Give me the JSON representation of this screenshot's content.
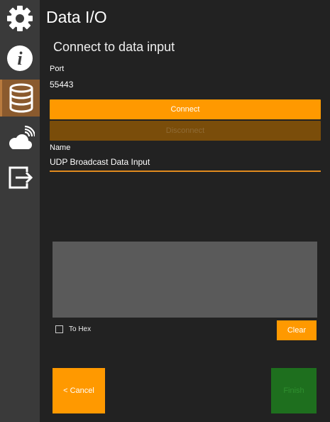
{
  "app": {
    "title": "Data I/O"
  },
  "section": {
    "title": "Connect to data input"
  },
  "sidebar": {
    "items": [
      {
        "icon": "gear-icon"
      },
      {
        "icon": "info-icon"
      },
      {
        "icon": "database-icon",
        "active": true
      },
      {
        "icon": "cloud-wifi-icon"
      },
      {
        "icon": "export-icon"
      }
    ]
  },
  "port": {
    "label": "Port",
    "value": "55443"
  },
  "connect": {
    "label": "Connect"
  },
  "disconnect": {
    "label": "Disconnect",
    "enabled": false
  },
  "name": {
    "label": "Name",
    "value": "UDP Broadcast Data Input"
  },
  "to_hex": {
    "label": "To Hex",
    "checked": false
  },
  "clear": {
    "label": "Clear"
  },
  "cancel": {
    "label": "< Cancel"
  },
  "finish": {
    "label": "Finish",
    "enabled": false
  },
  "colors": {
    "accent": "#ff9900",
    "sidebar_active": "#8a5a2e",
    "finish_disabled": "#1e6f1e"
  }
}
